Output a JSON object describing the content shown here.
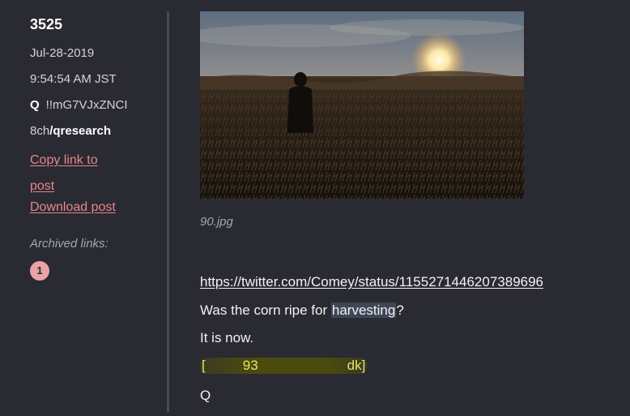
{
  "post": {
    "number": "3525",
    "date": "Jul-28-2019",
    "time": "9:54:54 AM JST",
    "author": "Q",
    "tripcode": "!!mG7VJxZNCI",
    "board_prefix": "8ch",
    "board_name": "/qresearch",
    "copy_link_label": "Copy link to post",
    "download_label": "Download post",
    "archived_label": "Archived links:",
    "archive_links": [
      "1"
    ]
  },
  "content": {
    "image_filename": "90.jpg",
    "image_icon": "photo-sunset-cornfield",
    "tweet_url": "https://twitter.com/Comey/status/1155271446207389696",
    "line1_pre": "Was the corn ripe for ",
    "line1_word": "harvesting",
    "line1_post": "?",
    "line2": "It is now.",
    "stringer_open": "[",
    "stringer_num": "93",
    "stringer_end": "dk]",
    "signature": "Q"
  },
  "colors": {
    "background": "#2a2a33",
    "link": "#e8868a",
    "highlight_text": "#e7e36a",
    "badge": "#e9a3a3"
  }
}
